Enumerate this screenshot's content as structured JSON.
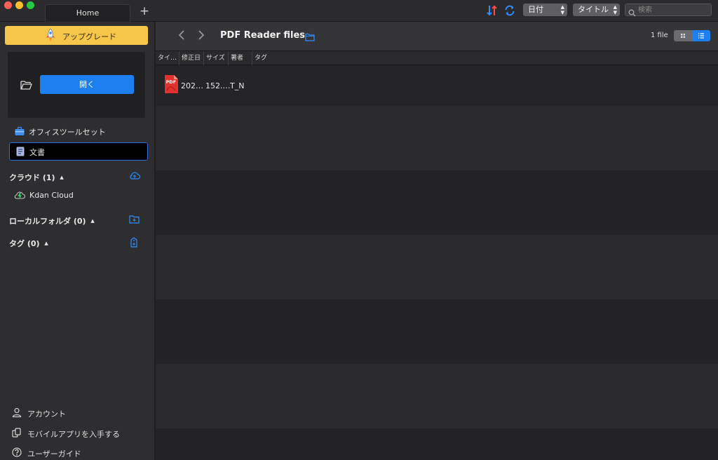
{
  "window": {
    "tab_label": "Home",
    "add_tab_label": "+"
  },
  "toolbar": {
    "sort_by": "日付",
    "order_by": "タイトル",
    "search_placeholder": "検索"
  },
  "sidebar": {
    "upgrade_label": "アップグレード",
    "open_label": "開く",
    "office_tools_label": "オフィスツールセット",
    "documents_label": "文書",
    "cloud_section": "クラウド (1)",
    "kdan_cloud_label": "Kdan Cloud",
    "local_section": "ローカルフォルダ (0)",
    "tag_section": "タグ (0)",
    "account_label": "アカウント",
    "mobile_app_label": "モバイルアプリを入手する",
    "user_guide_label": "ユーザーガイド"
  },
  "main": {
    "folder_title": "PDF Reader files",
    "file_count": "1 file",
    "columns": [
      "タイ…",
      "修正日",
      "サイズ",
      "著者",
      "タグ"
    ],
    "files": [
      {
        "icon_text": "PDF",
        "title": "202…",
        "size": "152.…",
        "author": "T_N"
      }
    ]
  },
  "colors": {
    "accent": "#1e7ff0",
    "upgrade": "#f6c64a",
    "pdf_red": "#e0322f"
  }
}
